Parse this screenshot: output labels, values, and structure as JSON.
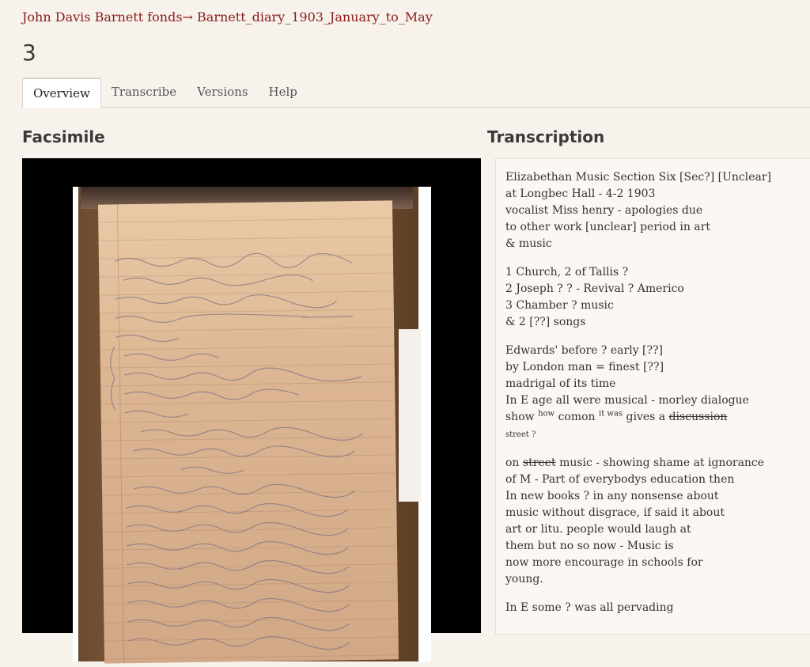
{
  "breadcrumb": {
    "collection": "John Davis Barnett fonds",
    "separator": "→",
    "work": "Barnett_diary_1903_January_to_May"
  },
  "page_title": "3",
  "tabs": [
    "Overview",
    "Transcribe",
    "Versions",
    "Help"
  ],
  "sections": {
    "facsimile": "Facsimile",
    "transcription": "Transcription"
  },
  "transcription": {
    "p1": [
      "Elizabethan Music Section Six [Sec?] [Unclear]",
      "at Longbec Hall - 4-2 1903",
      "vocalist Miss henry - apologies due",
      "to other work [unclear] period in art",
      "& music"
    ],
    "p2": [
      "1 Church, 2 of Tallis ?",
      "2 Joseph ? ? - Revival ? Americo",
      "3 Chamber ? music",
      "& 2 [??] songs"
    ],
    "p3": [
      "Edwards' before ? early [??]",
      "by London man = finest [??]",
      "madrigal of its time",
      "In E age all were musical - morley dialogue"
    ],
    "p3_show": {
      "a": "show",
      "sup1": "how",
      "b": "comon",
      "sup2": "it was",
      "c": "gives a",
      "struck": "discussion",
      "below": "street ?"
    },
    "p4_first": {
      "a": "on",
      "struck": "street",
      "b": "music - showing shame at ignorance"
    },
    "p4": [
      "of M - Part of everybodys education then",
      "In new books ? in any nonsense about",
      "music without disgrace, if said it about",
      "art or litu. people would laugh at",
      "them but no so now - Music is",
      "now more encourage in schools for",
      "young."
    ],
    "p5": [
      "In E some ? was all pervading"
    ]
  }
}
